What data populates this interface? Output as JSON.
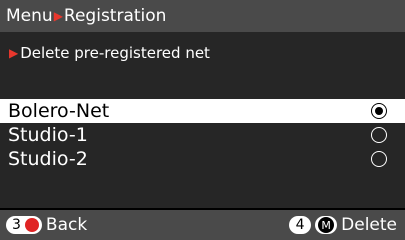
{
  "header": {
    "menu": "Menu",
    "section": "Registration"
  },
  "subtitle": "Delete pre-registered net",
  "nets": [
    {
      "name": "Bolero-Net",
      "selected": true
    },
    {
      "name": "Studio-1",
      "selected": false
    },
    {
      "name": "Studio-2",
      "selected": false
    }
  ],
  "footer": {
    "back_num": "3",
    "back_label": "Back",
    "delete_num": "4",
    "delete_key": "M",
    "delete_label": "Delete"
  },
  "colors": {
    "accent_arrow": "#e8372d",
    "record": "#e02424",
    "bar": "#4a4a4a",
    "panel": "#262626"
  },
  "icons": {
    "breadcrumb_sep": "red-triangle-arrow-icon",
    "record": "red-record-dot-icon",
    "m_key": "m-circle-icon"
  }
}
